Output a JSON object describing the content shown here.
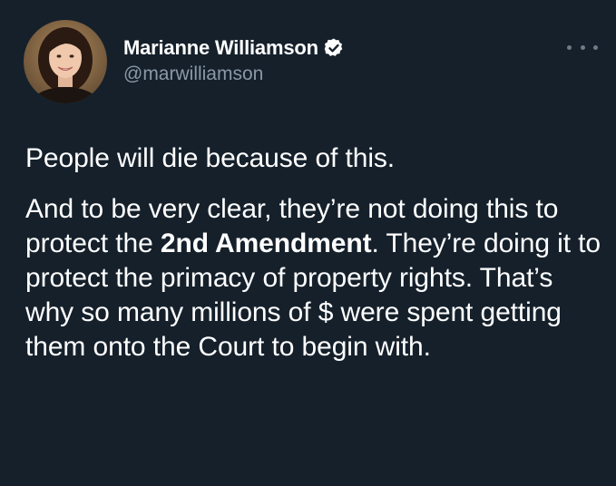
{
  "tweet": {
    "display_name": "Marianne Williamson",
    "handle": "@marwilliamson",
    "verified": true,
    "verified_icon": "verified-badge-icon",
    "more_icon": "more-horizontal-icon",
    "text": {
      "para1": "People will die because of this.",
      "para2_before": "And to be very clear, they’re not doing this to protect the ",
      "para2_bold": "2nd Amendment",
      "para2_after": ". They’re doing it to protect the primacy of property rights. That’s why so many millions of $ were spent getting them onto the Court to begin with."
    }
  },
  "colors": {
    "background": "#15202b",
    "text": "#ffffff",
    "secondary_text": "#8b98a5",
    "verified_badge": "#ffffff"
  }
}
